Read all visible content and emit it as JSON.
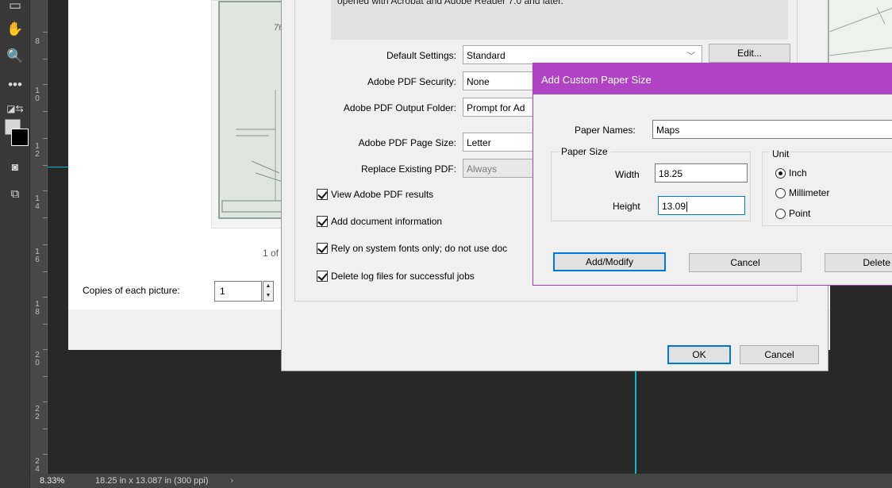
{
  "app": {
    "zoom": "8.33%",
    "doc_info": "18.25 in x 13.087 in (300 ppi)",
    "status_arrow": "›",
    "ruler_numbers": [
      "8",
      "1\n0",
      "1\n2",
      "1\n4",
      "1\n6",
      "1\n8",
      "2\n0",
      "2\n2",
      "2\n4"
    ]
  },
  "print_window": {
    "preview_label": "76",
    "page_count": "1 of",
    "copies_label": "Copies of each picture:",
    "copies_value": "1"
  },
  "pdf_dialog": {
    "description": "opened with Acrobat and Adobe Reader 7.0 and later.",
    "fields": {
      "default_settings": {
        "label": "Default Settings:",
        "value": "Standard"
      },
      "security": {
        "label": "Adobe PDF Security:",
        "value": "None"
      },
      "output_folder": {
        "label": "Adobe PDF Output Folder:",
        "value": "Prompt for Ad"
      },
      "page_size": {
        "label": "Adobe PDF Page Size:",
        "value": "Letter"
      },
      "replace": {
        "label": "Replace Existing PDF:",
        "value": "Always"
      }
    },
    "edit_label": "Edit...",
    "checkboxes": [
      {
        "label": "View Adobe PDF results",
        "checked": true
      },
      {
        "label": "Add document information",
        "checked": true
      },
      {
        "label": "Rely on system fonts only; do not use doc",
        "checked": true
      },
      {
        "label": "Delete log files for successful jobs",
        "checked": true
      }
    ],
    "ok_label": "OK",
    "cancel_label": "Cancel"
  },
  "paper_dialog": {
    "title": "Add Custom Paper Size",
    "paper_names_label": "Paper Names:",
    "paper_names_value": "Maps",
    "paper_size_group": "Paper Size",
    "width_label": "Width",
    "width_value": "18.25",
    "height_label": "Height",
    "height_value": "13.09",
    "unit_group": "Unit",
    "units": [
      {
        "label": "Inch",
        "selected": true
      },
      {
        "label": "Millimeter",
        "selected": false
      },
      {
        "label": "Point",
        "selected": false
      }
    ],
    "add_modify_label": "Add/Modify",
    "cancel_label": "Cancel",
    "delete_label": "Delete"
  }
}
